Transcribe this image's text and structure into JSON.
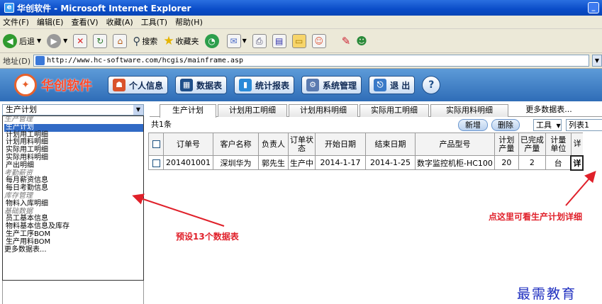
{
  "window": {
    "title": "华创软件 - Microsoft Internet Explorer"
  },
  "menu": [
    "文件(F)",
    "编辑(E)",
    "查看(V)",
    "收藏(A)",
    "工具(T)",
    "帮助(H)"
  ],
  "toolbar": {
    "back": "后退",
    "search": "搜索",
    "favorites": "收藏夹"
  },
  "address": {
    "label": "地址(D)",
    "url": "http://www.hc-software.com/hcgis/mainframe.asp"
  },
  "app": {
    "logo_text": "华创软件",
    "buttons": [
      "个人信息",
      "数据表",
      "统计报表",
      "系统管理",
      "退 出",
      "?"
    ]
  },
  "sidebar": {
    "selected": "生产计划",
    "list": [
      {
        "type": "group",
        "label": "生产管理"
      },
      {
        "type": "item",
        "label": "生产计划",
        "selected": true
      },
      {
        "type": "item",
        "label": "计划用工明细"
      },
      {
        "type": "item",
        "label": "计划用料明细"
      },
      {
        "type": "item",
        "label": "实际用工明细"
      },
      {
        "type": "item",
        "label": "实际用料明细"
      },
      {
        "type": "item",
        "label": "产出明细"
      },
      {
        "type": "group",
        "label": "考勤薪资"
      },
      {
        "type": "item",
        "label": "每月薪资信息"
      },
      {
        "type": "item",
        "label": "每日考勤信息"
      },
      {
        "type": "group",
        "label": "库存管理"
      },
      {
        "type": "item",
        "label": "物料入库明细"
      },
      {
        "type": "group",
        "label": "基础数据"
      },
      {
        "type": "item",
        "label": "员工基本信息"
      },
      {
        "type": "item",
        "label": "物料基本信息及库存"
      },
      {
        "type": "item",
        "label": "生产工序BOM"
      },
      {
        "type": "item",
        "label": "生产用料BOM"
      },
      {
        "type": "more",
        "label": "更多数据表..."
      }
    ]
  },
  "tabs": [
    "生产计划",
    "计划用工明细",
    "计划用料明细",
    "实际用工明细",
    "实际用料明细",
    "更多数据表..."
  ],
  "grid": {
    "count": "共1条",
    "actions": {
      "add": "新增",
      "delete": "删除",
      "tools": "工具",
      "view": "列表1"
    },
    "columns": [
      "订单号",
      "客户名称",
      "负责人",
      "订单状态",
      "开始日期",
      "结束日期",
      "产品型号",
      "计划产量",
      "已完成产量",
      "计量单位",
      "详"
    ],
    "rows": [
      [
        "201401001",
        "深圳华为",
        "郭先生",
        "生产中",
        "2014-1-17",
        "2014-1-25",
        "数字监控机柜-HC100",
        "20",
        "2",
        "台",
        "详"
      ]
    ]
  },
  "annotations": {
    "left": "预设13个数据表",
    "right": "点这里可看生产计划详细",
    "watermark": "最需教育"
  },
  "colors": {
    "annotation": "#e0202a",
    "selection": "#316ac5",
    "watermark": "#2030c0"
  }
}
